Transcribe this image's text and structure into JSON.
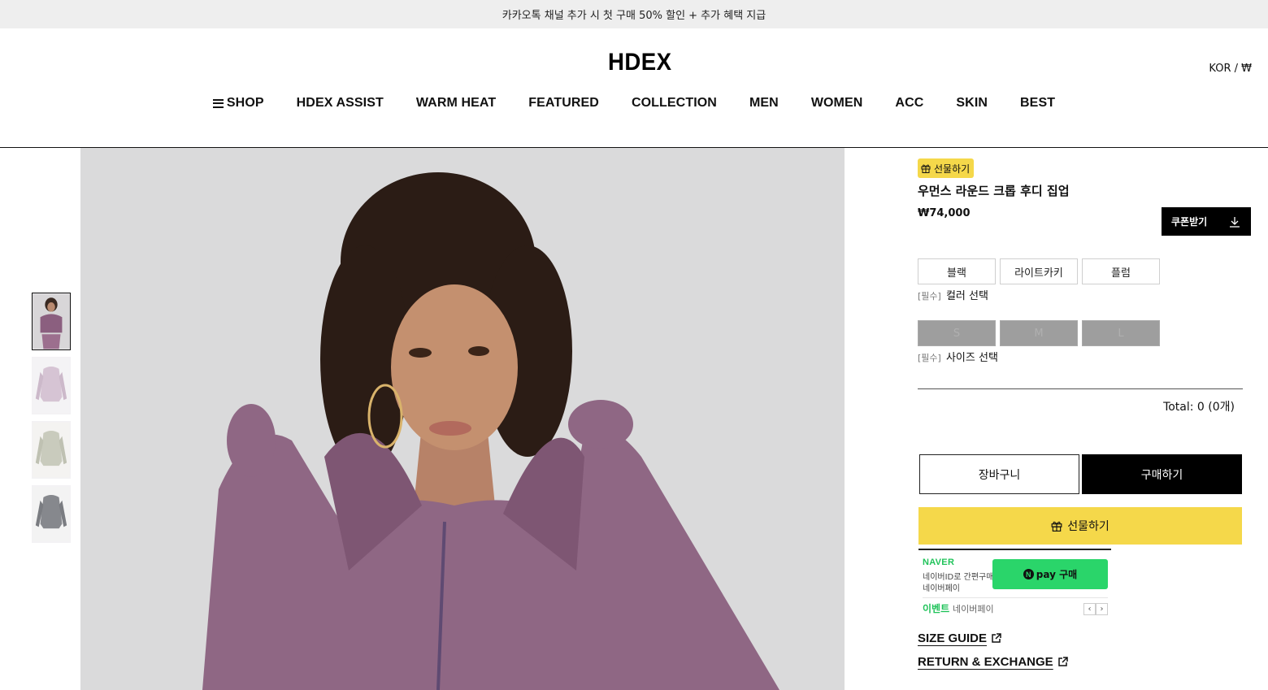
{
  "announcement": "카카오톡 채널 추가 시 첫 구매 50% 할인 + 추가 혜택 지급",
  "header": {
    "logo": "HDEX",
    "locale": "KOR / ₩"
  },
  "nav": [
    "SHOP",
    "HDEX ASSIST",
    "WARM HEAT",
    "FEATURED",
    "COLLECTION",
    "MEN",
    "WOMEN",
    "ACC",
    "SKIN",
    "BEST"
  ],
  "product": {
    "gift_badge": "선물하기",
    "name": "우먼스 라운드 크롭 후디 집업",
    "price": "₩74,000",
    "coupon_label": "쿠폰받기",
    "colors": [
      "블랙",
      "라이트카키",
      "플럼"
    ],
    "color_required": "[필수]",
    "color_label": "컬러 선택",
    "sizes": [
      "S",
      "M",
      "L"
    ],
    "size_required": "[필수]",
    "size_label": "사이즈 선택",
    "total": "Total: 0 (0개)"
  },
  "actions": {
    "cart": "장바구니",
    "buy": "구매하기",
    "gift": "선물하기"
  },
  "npay": {
    "brand": "NAVER",
    "desc_line1": "네이버ID로 간편구매",
    "desc_line2": "네이버페이",
    "buy_label": "pay 구매",
    "n_mark": "N",
    "event_label": "이벤트",
    "event_text": "네이버페이",
    "prev": "‹",
    "next": "›"
  },
  "links": {
    "size_guide": "SIZE GUIDE",
    "return_exchange": "RETURN & EXCHANGE"
  },
  "colors": {
    "accent_yellow": "#f5d84a",
    "npay_green": "#2ad56a",
    "announce_bg": "#eeeeee"
  }
}
